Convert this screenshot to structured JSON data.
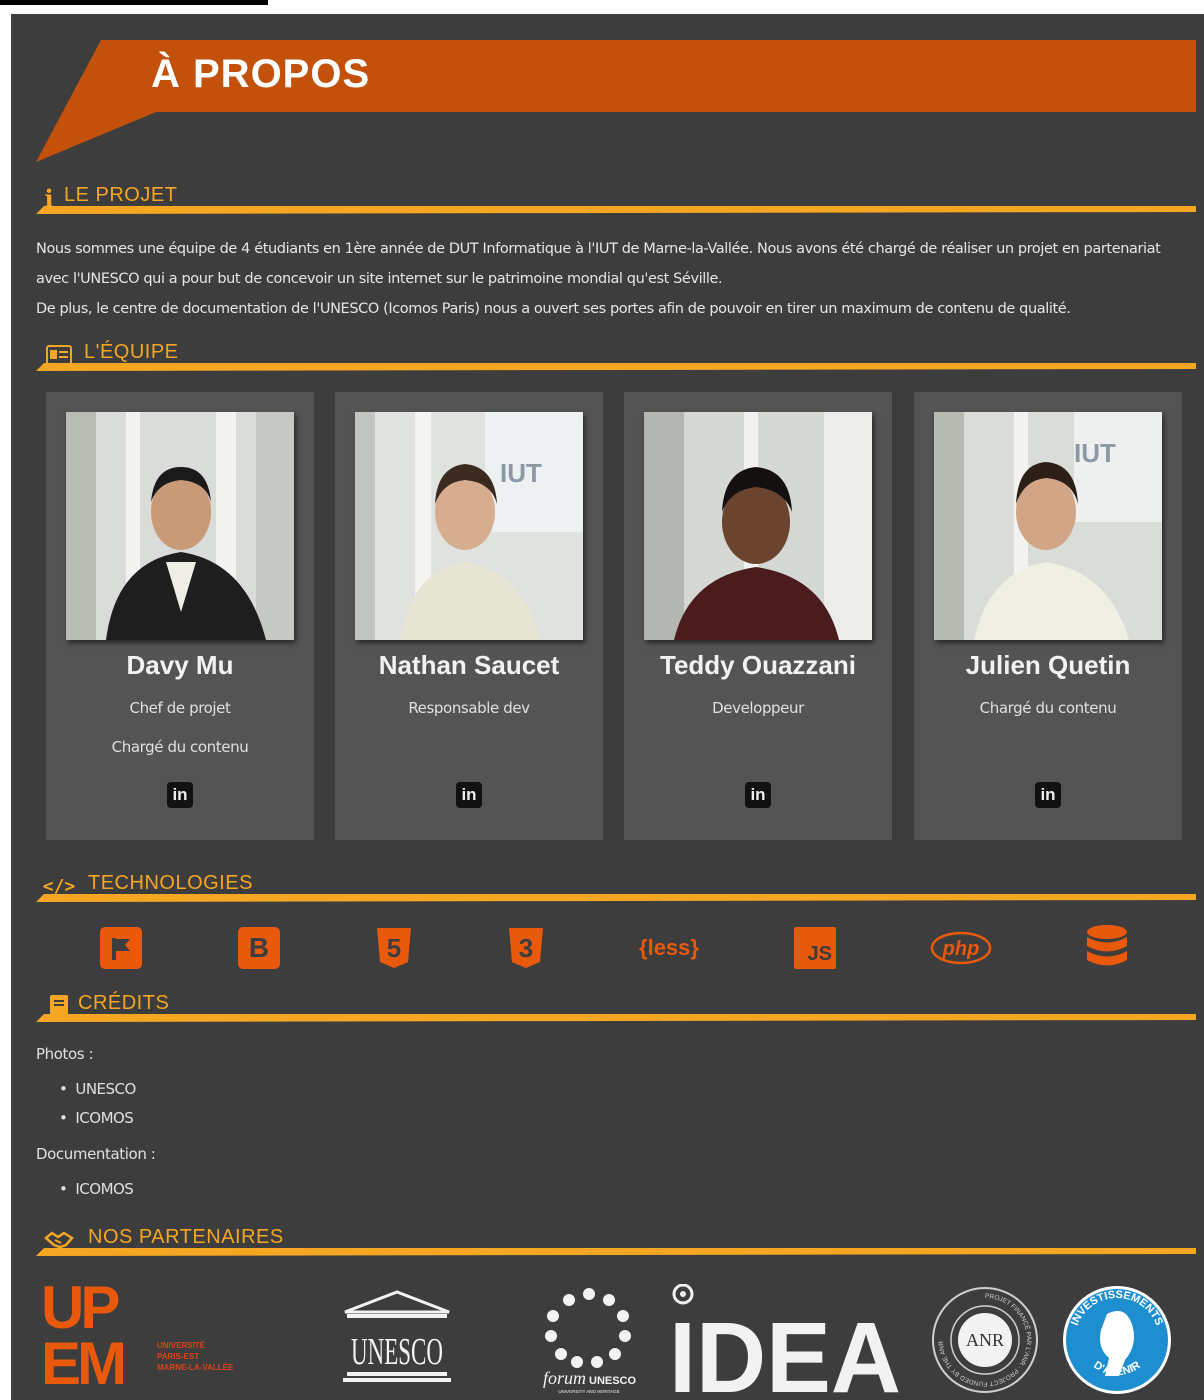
{
  "page": {
    "title": "À PROPOS"
  },
  "colors": {
    "accent": "#f5a623",
    "banner": "#c4510b",
    "tech": "#e8590c",
    "background": "#3d3d3d",
    "card": "#545454"
  },
  "sections": {
    "project": {
      "title": "LE PROJET",
      "icon": "info-icon",
      "paragraphs": [
        "Nous sommes une équipe de 4 étudiants en 1ère année de DUT Informatique à l'IUT de Marne-la-Vallée. Nous avons été chargé de réaliser un projet en partenariat avec l'UNESCO qui a pour but de concevoir un site internet sur le patrimoine mondial qu'est Séville.",
        "De plus, le centre de documentation de l'UNESCO (Icomos Paris) nous a ouvert ses portes afin de pouvoir en tirer un maximum de contenu de qualité."
      ]
    },
    "team": {
      "title": "L'ÉQUIPE",
      "icon": "id-card-icon"
    },
    "technologies": {
      "title": "TECHNOLOGIES",
      "icon": "code-icon"
    },
    "credits": {
      "title": "CRÉDITS",
      "icon": "book-icon"
    },
    "partners": {
      "title": "NOS PARTENAIRES",
      "icon": "handshake-icon"
    }
  },
  "team": [
    {
      "name": "Davy Mu",
      "roles": [
        "Chef de projet",
        "Chargé du contenu"
      ],
      "link_icon": "linkedin-icon",
      "link_text": "in"
    },
    {
      "name": "Nathan Saucet",
      "roles": [
        "Responsable dev"
      ],
      "link_icon": "linkedin-icon",
      "link_text": "in"
    },
    {
      "name": "Teddy Ouazzani",
      "roles": [
        "Developpeur"
      ],
      "link_icon": "linkedin-icon",
      "link_text": "in"
    },
    {
      "name": "Julien Quetin",
      "roles": [
        "Chargé du contenu"
      ],
      "link_icon": "linkedin-icon",
      "link_text": "in"
    }
  ],
  "technologies": [
    {
      "icon": "flag-icon",
      "text": ""
    },
    {
      "icon": "bootstrap-icon",
      "text": "B"
    },
    {
      "icon": "html5-icon",
      "text": "5"
    },
    {
      "icon": "css3-icon",
      "text": "3"
    },
    {
      "icon": "less-icon",
      "text": "{less}"
    },
    {
      "icon": "javascript-icon",
      "text": "JS"
    },
    {
      "icon": "php-icon",
      "text": "php"
    },
    {
      "icon": "database-icon",
      "text": ""
    }
  ],
  "credits": {
    "photos_label": "Photos :",
    "photos": [
      "UNESCO",
      "ICOMOS"
    ],
    "documentation_label": "Documentation :",
    "documentation": [
      "ICOMOS"
    ]
  },
  "partners": {
    "upem": {
      "letters_top": "UP",
      "letters_bottom": "EM",
      "lines": [
        "UNIVERSITÉ",
        "PARIS-EST",
        "MARNE-LA-VALLÉE"
      ]
    },
    "unesco": {
      "text": "UNESCO"
    },
    "forum": {
      "text": "forum",
      "brand": "UNESCO",
      "subtitle": "UNIVERSITY AND HERITAGE"
    },
    "idea": {
      "text": "IDEA"
    },
    "anr": {
      "text": "ANR",
      "ring": "PROJET FINANCÉ PAR L'ANR · PROJECT FUNDED BY THE ANR"
    },
    "investissements": {
      "top": "INVESTISSEMENTS",
      "bottom": "D'AVENIR"
    }
  }
}
